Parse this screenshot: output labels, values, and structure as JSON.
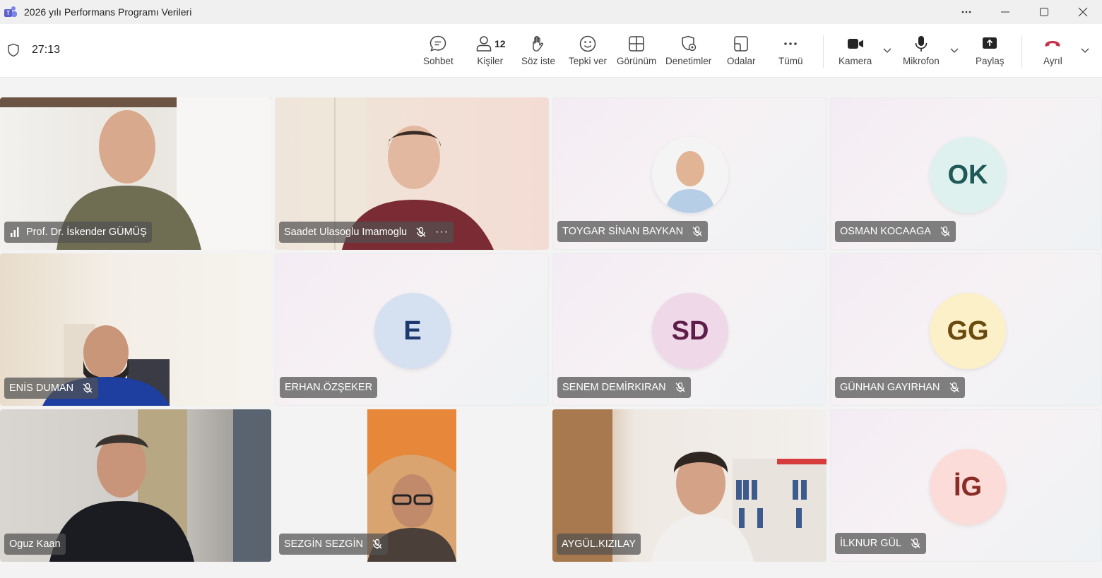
{
  "window": {
    "title": "2026 yılı Performans Programı Verileri",
    "controls": [
      "more-icon",
      "minimize-icon",
      "maximize-icon",
      "close-icon"
    ]
  },
  "meeting": {
    "timer": "27:13",
    "people_count": "12"
  },
  "toolbar": {
    "chat": "Sohbet",
    "people": "Kişiler",
    "raise": "Söz iste",
    "react": "Tepki ver",
    "view": "Görünüm",
    "controls": "Denetimler",
    "rooms": "Odalar",
    "more": "Tümü",
    "camera": "Kamera",
    "mic": "Mikrofon",
    "share": "Paylaş",
    "leave": "Ayrıl"
  },
  "colors": {
    "leave": "#c4314b",
    "accent": "#5b5fc7"
  },
  "participants": [
    {
      "name": "Prof. Dr. İskender GÜMÜŞ",
      "type": "video",
      "muted": false,
      "speaking": true
    },
    {
      "name": "Saadet Ulasoglu Imamoglu",
      "type": "video",
      "muted": true,
      "more": "···"
    },
    {
      "name": "TOYGAR SİNAN BAYKAN",
      "type": "photo",
      "muted": true
    },
    {
      "name": "OSMAN KOCAAGA",
      "type": "initials",
      "initials": "OK",
      "muted": true
    },
    {
      "name": "ENİS DUMAN",
      "type": "video",
      "muted": true
    },
    {
      "name": "ERHAN.ÖZŞEKER",
      "type": "initials",
      "initials": "E",
      "muted": false
    },
    {
      "name": "SENEM DEMİRKIRAN",
      "type": "initials",
      "initials": "SD",
      "muted": true
    },
    {
      "name": "GÜNHAN GAYIRHAN",
      "type": "initials",
      "initials": "GG",
      "muted": true
    },
    {
      "name": "Oguz Kaan",
      "type": "video",
      "muted": false
    },
    {
      "name": "SEZGİN SEZGİN",
      "type": "video",
      "muted": true
    },
    {
      "name": "AYGÜL.KIZILAY",
      "type": "video",
      "muted": false
    },
    {
      "name": "İLKNUR GÜL",
      "type": "initials",
      "initials": "İG",
      "muted": true
    }
  ]
}
